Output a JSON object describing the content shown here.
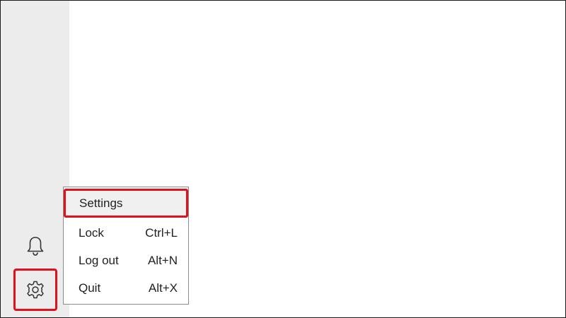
{
  "sidebar": {
    "icons": [
      {
        "name": "bell-icon"
      },
      {
        "name": "gear-icon"
      }
    ]
  },
  "menu": {
    "items": [
      {
        "label": "Settings",
        "shortcut": ""
      },
      {
        "label": "Lock",
        "shortcut": "Ctrl+L"
      },
      {
        "label": "Log out",
        "shortcut": "Alt+N"
      },
      {
        "label": "Quit",
        "shortcut": "Alt+X"
      }
    ]
  },
  "colors": {
    "highlight": "#e3101b",
    "sidebar_bg": "#ececec",
    "text": "#1f1f1f"
  }
}
